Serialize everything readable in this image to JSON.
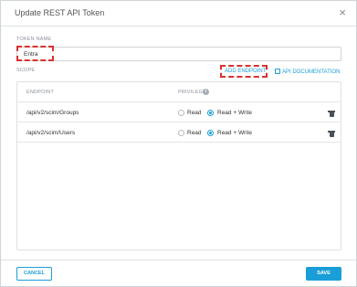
{
  "dialog": {
    "title": "Update REST API Token",
    "close_glyph": "×"
  },
  "token": {
    "label": "TOKEN NAME",
    "value": "Entra"
  },
  "scope": {
    "label": "SCOPE",
    "add_endpoint_label": "ADD ENDPOINT",
    "api_doc_label": "API DOCUMENTATION"
  },
  "table": {
    "headers": {
      "endpoint": "ENDPOINT",
      "privilege": "PRIVILEGE"
    },
    "rows": [
      {
        "path": "/api/v2/scim/Groups",
        "read_label": "Read",
        "readwrite_label": "Read + Write",
        "selected": "Read + Write"
      },
      {
        "path": "/api/v2/scim/Users",
        "read_label": "Read",
        "readwrite_label": "Read + Write",
        "selected": "Read + Write"
      }
    ]
  },
  "footer": {
    "cancel_label": "CANCEL",
    "save_label": "SAVE"
  },
  "colors": {
    "accent": "#1a9ed8",
    "annotation": "#d9322e"
  },
  "icons": {
    "close": "close-icon",
    "external_link": "external-link-icon",
    "info": "info-icon",
    "delete": "trash-icon"
  }
}
